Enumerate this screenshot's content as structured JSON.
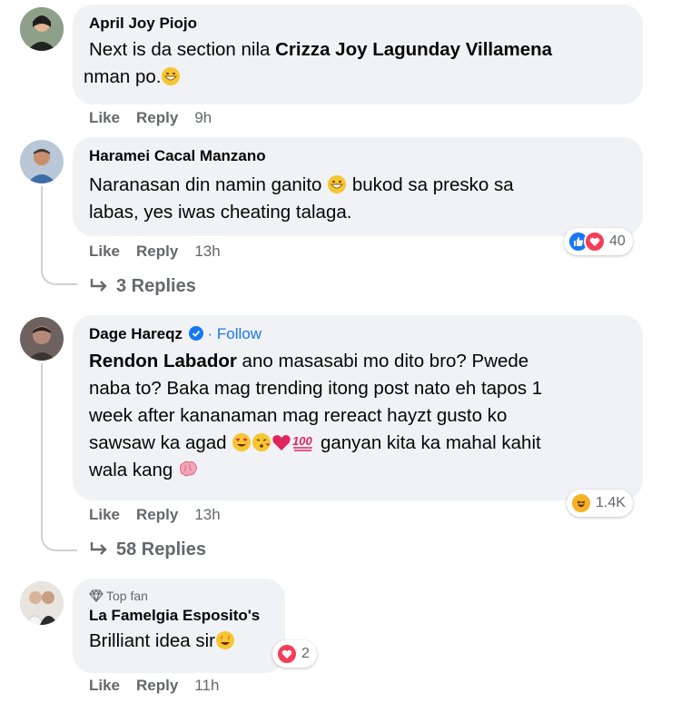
{
  "comments": [
    {
      "author": "April Joy Piojo",
      "body_pre": "Next is da section nila ",
      "mention": "Crizza Joy Lagunday Villamena",
      "body_post": " nman po.",
      "like": "Like",
      "reply": "Reply",
      "time": "9h"
    },
    {
      "author": "Haramei Cacal Manzano",
      "body_line1": "Naranasan din namin ganito",
      "body_line1_tail": " bukod sa presko sa",
      "body_line2": "labas, yes iwas cheating talaga.",
      "like": "Like",
      "reply": "Reply",
      "time": "13h",
      "reaction_count": "40",
      "replies": "3 Replies"
    },
    {
      "author": "Dage Hareqz",
      "follow_sep": "·",
      "follow": "Follow",
      "mention": "Rendon Labador",
      "line1": " ano masasabi mo dito bro? Pwede",
      "line2": "naba to? Baka mag trending itong post nato eh tapos 1",
      "line3": "week after kananaman mag rereact hayzt gusto ko",
      "line4_pre": "sawsaw ka agad",
      "line4_post": " ganyan kita ka mahal kahit",
      "line5": "wala kang",
      "like": "Like",
      "reply": "Reply",
      "time": "13h",
      "reaction_count": "1.4K",
      "replies": "58 Replies"
    },
    {
      "badge": "Top fan",
      "author": "La Famelgia Esposito's",
      "body": "Brilliant idea sir",
      "like": "Like",
      "reply": "Reply",
      "time": "11h",
      "reaction_count": "2"
    }
  ],
  "icons": {
    "like": "like-icon",
    "love": "heart-icon",
    "haha": "haha-icon",
    "verified": "verified-badge-icon",
    "reply_arrow": "reply-arrow-icon",
    "top_fan": "diamond-icon"
  },
  "colors": {
    "bubble": "#f0f2f5",
    "meta_text": "#65676b",
    "link_blue": "#1877f2",
    "like_blue": "#1877f2",
    "love_red": "#f33e58",
    "haha_yellow": "#f7b125"
  }
}
